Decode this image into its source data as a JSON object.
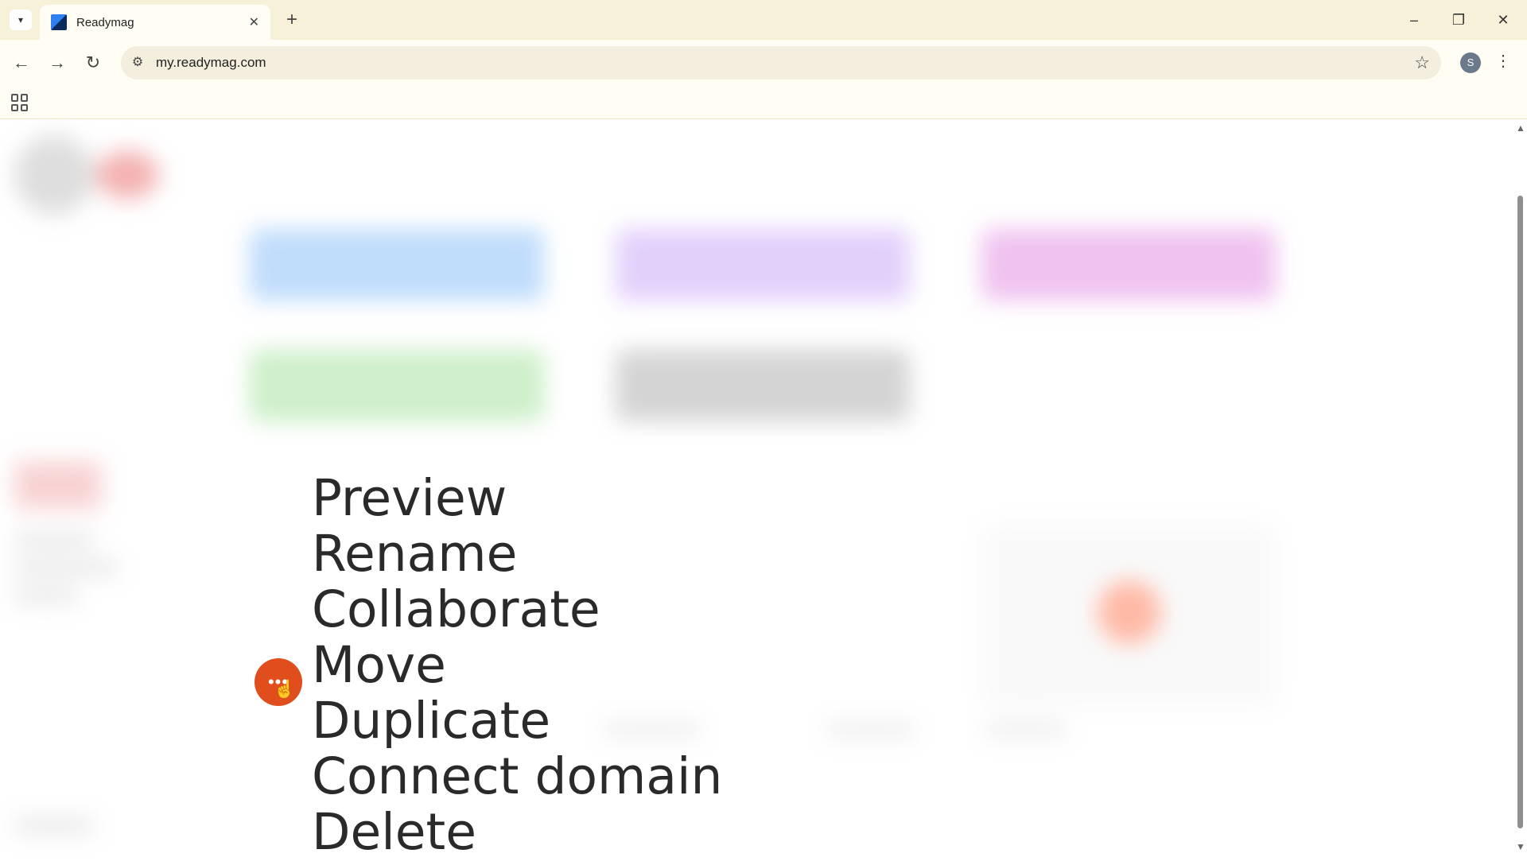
{
  "browser": {
    "tab_title": "Readymag",
    "tab_close": "✕",
    "new_tab": "+",
    "url": "my.readymag.com",
    "profile_initial": "S",
    "window": {
      "minimize": "–",
      "restore": "❐",
      "close": "✕"
    },
    "nav": {
      "back": "←",
      "forward": "→",
      "reload": "↻"
    }
  },
  "context_menu": {
    "trigger_label": "•••",
    "items": [
      "Preview",
      "Rename",
      "Collaborate",
      "Move",
      "Duplicate",
      "Connect domain",
      "Delete"
    ]
  },
  "colors": {
    "accent": "#e04e1e",
    "chrome_bg": "#f7f1d9"
  }
}
